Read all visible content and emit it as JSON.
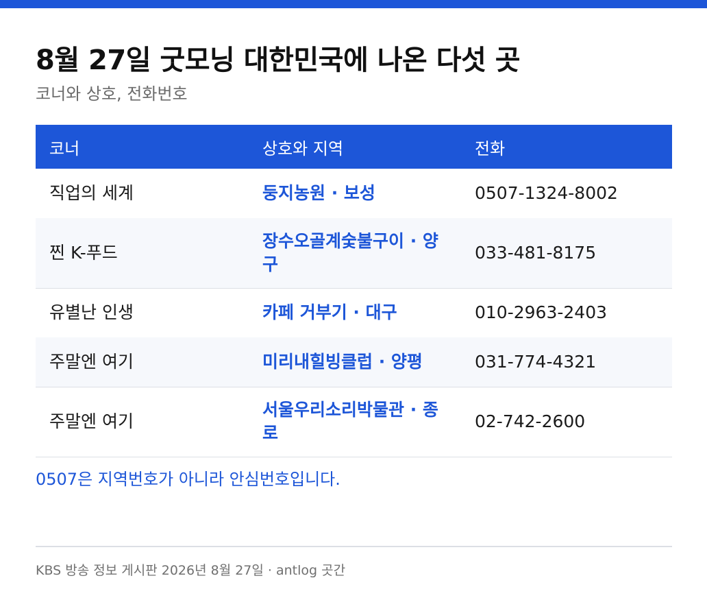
{
  "title": "8월 27일 굿모닝 대한민국에 나온 다섯 곳",
  "subtitle": "코너와 상호, 전화번호",
  "table": {
    "headers": {
      "corner": "코너",
      "store": "상호와 지역",
      "phone": "전화"
    },
    "rows": [
      {
        "corner": "직업의 세계",
        "store": "둥지농원 · 보성",
        "phone": "0507-1324-8002"
      },
      {
        "corner": "찐 K-푸드",
        "store": "장수오골계숯불구이 · 양구",
        "phone": "033-481-8175"
      },
      {
        "corner": "유별난 인생",
        "store": "카페 거부기 · 대구",
        "phone": "010-2963-2403"
      },
      {
        "corner": "주말엔 여기",
        "store": "미리내힐빙클럽 · 양평",
        "phone": "031-774-4321"
      },
      {
        "corner": "주말엔 여기",
        "store": "서울우리소리박물관 · 종로",
        "phone": "02-742-2600"
      }
    ]
  },
  "note": "0507은 지역번호가 아니라 안심번호입니다.",
  "footer": "KBS 방송 정보 게시판 2026년 8월 27일 · antlog 곳간",
  "colors": {
    "accent": "#1d56d8",
    "row_alt": "#f6f8fc",
    "divider": "#dcdfe5"
  }
}
